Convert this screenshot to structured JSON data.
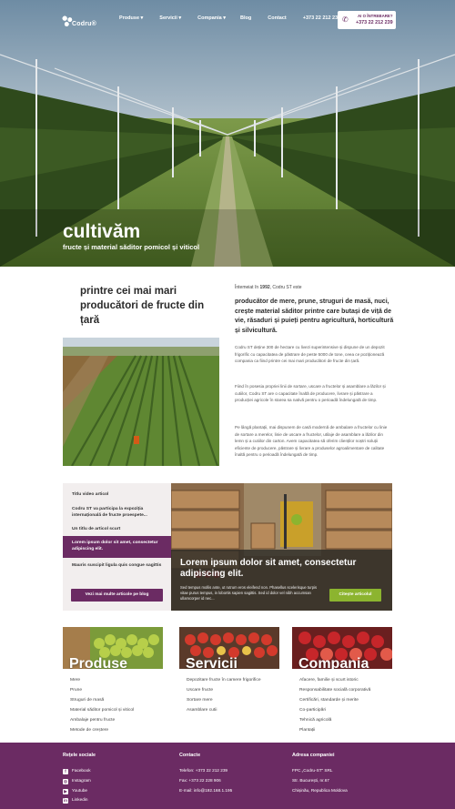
{
  "brand": {
    "logo_text": "Codru®"
  },
  "nav": {
    "items": [
      "Produse ▾",
      "Servicii ▾",
      "Compania ▾",
      "Blog",
      "Contact",
      "+373 22 212 239"
    ],
    "ask_label": "AI O ÎNTREBARE?",
    "ask_phone": "+373 22 212 239"
  },
  "hero": {
    "title": "cultivăm",
    "subtitle": "fructe și material săditor pomicol și viticol"
  },
  "intro": {
    "heading": "printre cei mai mari producători de fructe din țară",
    "date_prefix": "Întemeiat în ",
    "year": "1992",
    "date_suffix": ", Codru ST este",
    "lead": "producător de mere, prune, struguri de masă, nuci, crește material săditor printre care butași de viță de vie, răsaduri și puieți pentru agricultură, horticultură și silvicultură.",
    "p1": "Codru ST deține 300 de hectare cu livezi superintensive și dispune de un depozit frigorific cu capacitatea de păstrare de peste 5000 de tone, ceea ce poziționează compania ca fiind printre cei mai mari producători de fructe din țară.",
    "p2": "Fiind în posesia propriei linii de sortare, uscare a fructelor și asamblare a lăzilor și cutiilor, Codru ST are o capacitate înaltă de producere, livrare și păstrare a producției agricole în starea sa nativă pentru o perioadă îndelungată de timp.",
    "p3": "Pe lângă plantații, mai dispunem de casă modernă de ambalare a fructelor cu linie de sortare a merelor, linie de uscare a fructelor, utilaje de asamblare a lăzilor din lemn și a cutiilor din carton. Avem capacitatea să oferim clienților noștri soluții eficiente de producere, păstrare și livrare a produselor agroalimentare de calitate înaltă pentru o perioadă îndelungată de timp."
  },
  "articles": {
    "items": [
      "Titlu video articol",
      "Codru ST va participa la expoziția internațională de fructe proespete...",
      "Un titlu de articol scurt",
      "Lorem ipsum dolor sit amet, consectetur adipiscing elit.",
      "Mauris suscipit ligula quis congue sagittis"
    ],
    "more_button": "Vezi mai multe articole pe blog",
    "feature_title": "Lorem ipsum dolor sit amet, consectetur adipiscing elit.",
    "feature_text": "Sed tempus mollis ante, ut rutrum eros eleifend non. Phasellus scelerisque turpis vitae purus tempus, in lobortis sapien sagittis. Sed id dolor vel nibh accumsan ullamcorper id nec...",
    "feature_button": "Citește articolul"
  },
  "categories": [
    {
      "title": "Produse",
      "items": [
        "Mere",
        "Prune",
        "Struguri de masă",
        "Material săditor pomicol și viticol",
        "Ambalaje pentru fructe",
        "Metode de creștere"
      ]
    },
    {
      "title": "Servicii",
      "items": [
        "Depozitare fructe în camere frigorifice",
        "Uscare fructe",
        "Sortare mere",
        "Asamblare cutii"
      ]
    },
    {
      "title": "Compania",
      "items": [
        "Afacere, familie și scurt istoric",
        "Responsabilitate socială corporativă",
        "Certificări, standarde și merite",
        "Co-participări",
        "Tehnică agricolă",
        "Plantații"
      ]
    }
  ],
  "footer": {
    "social_title": "Rețele sociale",
    "social": [
      "Facebook",
      "Instagram",
      "Youtube",
      "Linkedin"
    ],
    "contact_title": "Contacte",
    "contact": [
      "Telefon:   +373 22 212 239",
      "Fax:   +373 22 228 906",
      "E-mail:  info@192.168.1.195"
    ],
    "address_title": "Adresa companiei",
    "address": [
      "FPC „Codru-ST” SRL",
      "Str. București, nr.67",
      "Chișinău, Republica Moldova"
    ]
  },
  "colors": {
    "brand": "#6b2b63",
    "accent_green": "#8cb42f"
  }
}
